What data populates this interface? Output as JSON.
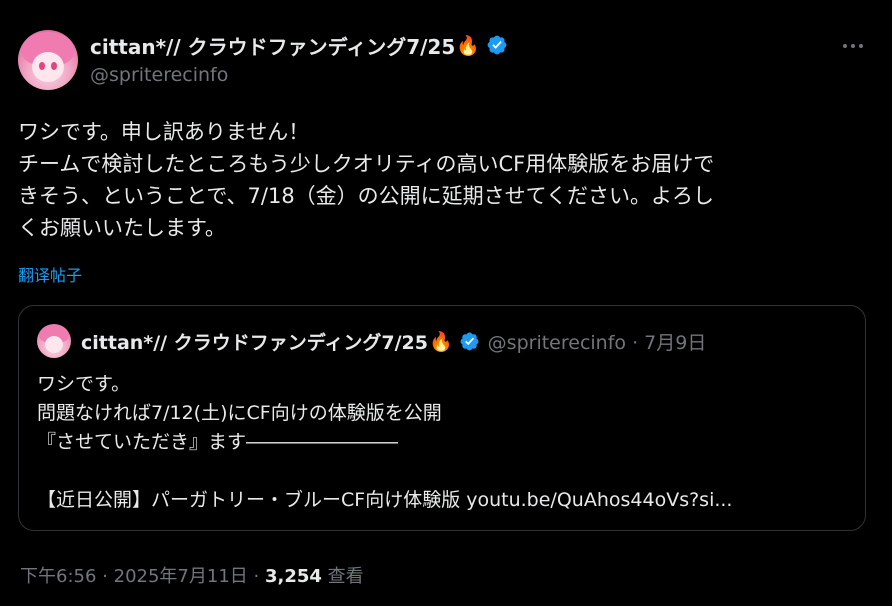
{
  "author": {
    "display_name": "cittan*// クラウドファンディング7/25",
    "emoji": "🔥",
    "handle": "@spriterecinfo"
  },
  "tweet": {
    "lines": [
      "ワシです。申し訳ありません！",
      "チームで検討したところもう少しクオリティの高いCF用体験版をお届けで",
      "きそう、ということで、7/18（金）の公開に延期させてください。よろし",
      "くお願いいたします。"
    ],
    "translate_label": "翻译帖子"
  },
  "quote": {
    "display_name": "cittan*// クラウドファンディング7/25",
    "emoji": "🔥",
    "handle_date": "@spriterecinfo · 7月9日",
    "lines": [
      "ワシです。",
      "問題なければ7/12(土)にCF向けの体験版を公開",
      "『させていただき』ます――――――――",
      "",
      "【近日公開】パーガトリー・ブルーCF向け体験版 youtu.be/QuAhos44oVs?si..."
    ]
  },
  "meta": {
    "time": "下午6:56",
    "separator": "·",
    "date": "2025年7月11日",
    "views_count": "3,254",
    "views_label": "查看"
  },
  "colors": {
    "background": "#000000",
    "text": "#e7e9ea",
    "secondary": "#71767b",
    "link": "#1d9bf0",
    "border": "#2f3336",
    "verified": "#1d9bf0"
  },
  "icons": {
    "verified": "verified-badge-icon",
    "more": "more-dots-icon"
  }
}
